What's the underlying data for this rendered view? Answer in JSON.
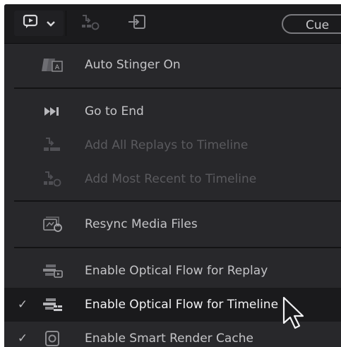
{
  "toolbar": {
    "cue_label": "Cue",
    "icons": [
      "replay-menu-icon",
      "chevron-down-icon",
      "add-recent-timeline-icon",
      "import-icon"
    ]
  },
  "menu": {
    "items": [
      {
        "label": "Auto Stinger On",
        "icon": "stinger-icon",
        "checked": false,
        "disabled": false
      },
      {
        "label": "Go to End",
        "icon": "go-to-end-icon",
        "checked": false,
        "disabled": false
      },
      {
        "label": "Add All Replays to Timeline",
        "icon": "add-all-timeline-icon",
        "checked": false,
        "disabled": true
      },
      {
        "label": "Add Most Recent to Timeline",
        "icon": "add-recent-timeline-icon",
        "checked": false,
        "disabled": true
      },
      {
        "label": "Resync Media Files",
        "icon": "resync-media-icon",
        "checked": false,
        "disabled": false
      },
      {
        "label": "Enable Optical Flow for Replay",
        "icon": "optical-flow-replay-icon",
        "checked": false,
        "disabled": false
      },
      {
        "label": "Enable Optical Flow for Timeline",
        "icon": "optical-flow-timeline-icon",
        "checked": true,
        "disabled": false
      },
      {
        "label": "Enable Smart Render Cache",
        "icon": "render-cache-icon",
        "checked": true,
        "disabled": false
      }
    ],
    "check_glyph": "✓"
  },
  "colors": {
    "background": "#28282b",
    "toolbar": "#1b1b1d",
    "highlight": "#1a1a1c",
    "text": "#c4c4c7",
    "text_disabled": "#5a5a5e"
  }
}
